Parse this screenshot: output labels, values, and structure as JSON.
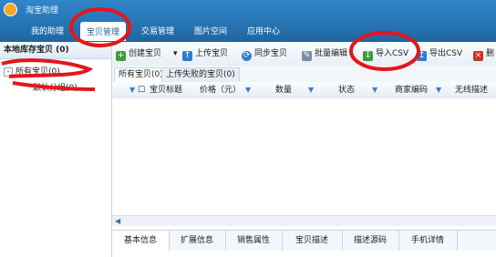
{
  "window": {
    "title": "淘宝助理"
  },
  "navbar": {
    "items": [
      {
        "label": "我的助理"
      },
      {
        "label": "宝贝管理"
      },
      {
        "label": "交易管理"
      },
      {
        "label": "图片空间"
      },
      {
        "label": "应用中心"
      }
    ],
    "active_index": 1
  },
  "sidebar": {
    "header": "本地库存宝贝 (0)",
    "tree": [
      {
        "label": "所有宝贝(0)",
        "expander": "-"
      },
      {
        "label": "默认分组(0)"
      }
    ]
  },
  "toolbar": {
    "create": "创建宝贝",
    "upload": "上传宝贝",
    "sync": "同步宝贝",
    "batch_edit": "批量编辑",
    "import_csv": "导入CSV",
    "export_csv": "导出CSV",
    "more": "删"
  },
  "list_tabs": [
    {
      "label": "所有宝贝(0)"
    },
    {
      "label": "上传失败的宝贝(0)"
    }
  ],
  "grid": {
    "columns": [
      "宝贝标题",
      "价格（元）",
      "数量",
      "状态",
      "商家编码",
      "无线描述"
    ],
    "rows": []
  },
  "bottom_tabs": [
    "基本信息",
    "扩展信息",
    "销售属性",
    "宝贝描述",
    "描述源码",
    "手机详情"
  ],
  "colors": {
    "accent": "#1f66a1",
    "annotation": "#e3161b"
  }
}
